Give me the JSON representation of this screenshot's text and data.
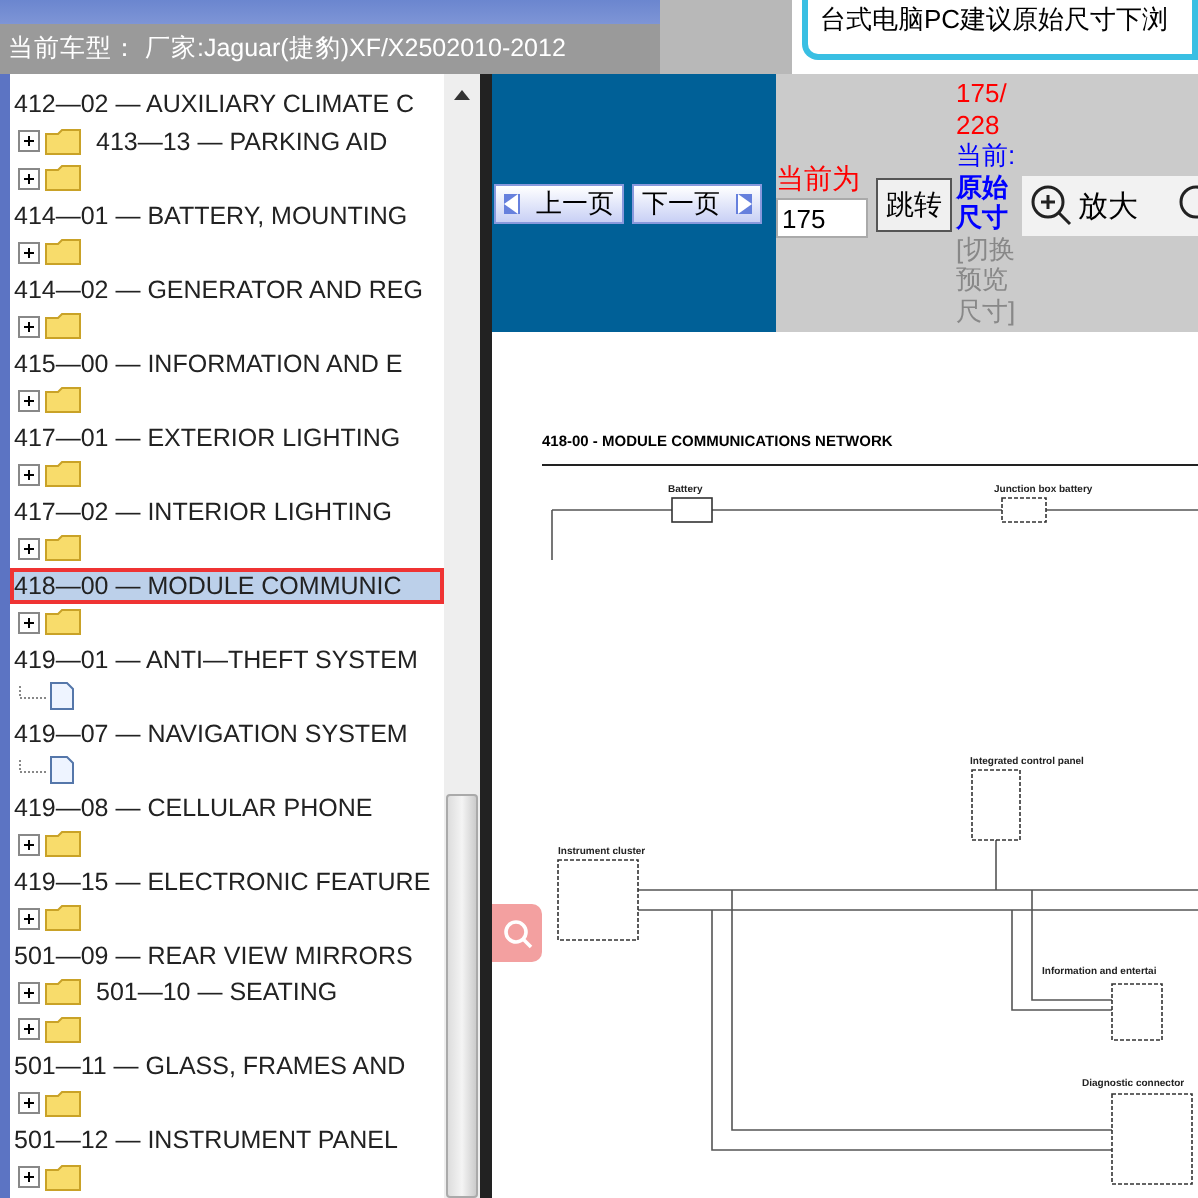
{
  "header": {
    "model_text": "当前车型： 厂家:Jaguar(捷豹)XF/X2502010-2012"
  },
  "banner": {
    "message": "台式电脑PC建议原始尺寸下浏"
  },
  "tree": {
    "rows": [
      {
        "kind": "label",
        "text": "412—02 — AUXILIARY CLIMATE C",
        "selected": false
      },
      {
        "kind": "folder",
        "text": "413—13 — PARKING AID"
      },
      {
        "kind": "folder"
      },
      {
        "kind": "label",
        "text": "414—01 — BATTERY, MOUNTING",
        "selected": false
      },
      {
        "kind": "folder"
      },
      {
        "kind": "label",
        "text": "414—02 — GENERATOR AND REG",
        "selected": false
      },
      {
        "kind": "folder"
      },
      {
        "kind": "label",
        "text": "415—00 — INFORMATION AND E",
        "selected": false
      },
      {
        "kind": "folder"
      },
      {
        "kind": "label",
        "text": "417—01 — EXTERIOR LIGHTING",
        "selected": false
      },
      {
        "kind": "folder"
      },
      {
        "kind": "label",
        "text": "417—02 — INTERIOR LIGHTING",
        "selected": false
      },
      {
        "kind": "folder"
      },
      {
        "kind": "label",
        "text": "418—00 — MODULE COMMUNIC",
        "selected": true
      },
      {
        "kind": "folder"
      },
      {
        "kind": "label",
        "text": "419—01 — ANTI—THEFT SYSTEM",
        "selected": false
      },
      {
        "kind": "page"
      },
      {
        "kind": "label",
        "text": "419—07 — NAVIGATION SYSTEM",
        "selected": false
      },
      {
        "kind": "page"
      },
      {
        "kind": "label",
        "text": "419—08 — CELLULAR PHONE",
        "selected": false
      },
      {
        "kind": "folder"
      },
      {
        "kind": "label",
        "text": "419—15 — ELECTRONIC FEATURE",
        "selected": false
      },
      {
        "kind": "folder"
      },
      {
        "kind": "label",
        "text": "501—09 — REAR VIEW MIRRORS",
        "selected": false
      },
      {
        "kind": "folder",
        "text": "501—10 — SEATING"
      },
      {
        "kind": "folder"
      },
      {
        "kind": "label",
        "text": "501—11 — GLASS, FRAMES AND",
        "selected": false
      },
      {
        "kind": "folder"
      },
      {
        "kind": "label",
        "text": "501—12 — INSTRUMENT PANEL",
        "selected": false
      },
      {
        "kind": "folder"
      }
    ]
  },
  "toolbar": {
    "prev_button": "上一页",
    "next_button": "下一页",
    "current_label": "当前为",
    "page_input": "175",
    "go_button": "跳转",
    "page_count": "175/228",
    "size_label": "当前:",
    "size_value": "原始尺寸",
    "size_toggle": "[切换预览尺寸]",
    "zoom_in_button": "放大"
  },
  "document": {
    "title": "418-00 - MODULE COMMUNICATIONS NETWORK",
    "components": [
      "Battery",
      "Junction box battery",
      "Integrated control panel",
      "Instrument cluster",
      "Information and entertai",
      "Diagnostic connector"
    ]
  }
}
